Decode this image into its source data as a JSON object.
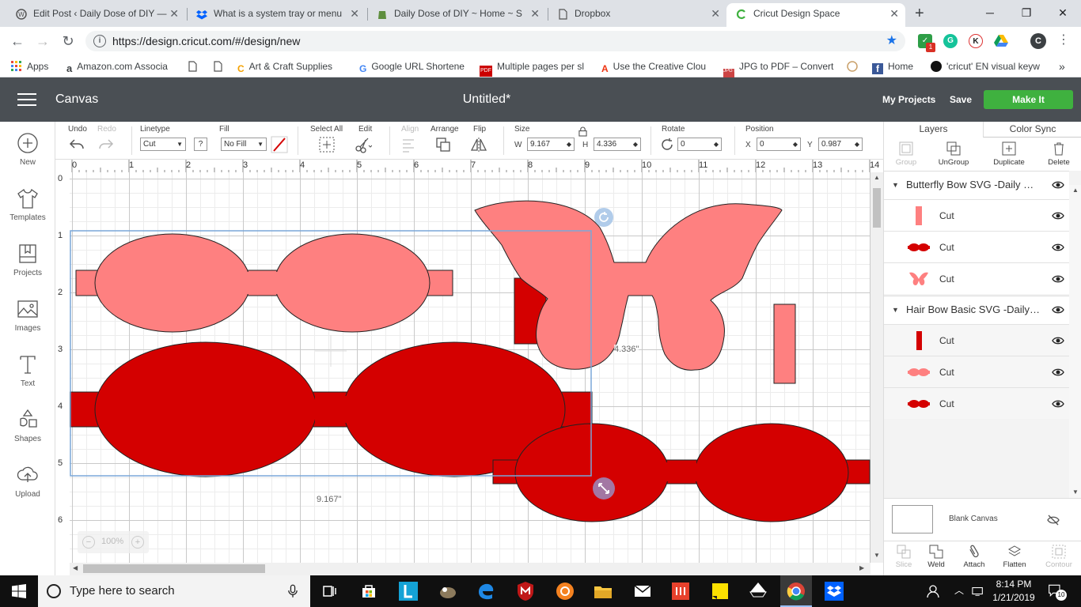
{
  "browser": {
    "tabs": [
      {
        "title": "Edit Post ‹ Daily Dose of DIY —",
        "active": false
      },
      {
        "title": "What is a system tray or menu",
        "active": false
      },
      {
        "title": "Daily Dose of DIY ~ Home ~ S",
        "active": false
      },
      {
        "title": "Dropbox",
        "active": false
      },
      {
        "title": "Cricut Design Space",
        "active": true
      }
    ],
    "new_tab": "+",
    "url": "https://design.cricut.com/#/design/new",
    "extension_badge": "1",
    "ext_k": "K",
    "profile": "C",
    "bookmarks": [
      "Apps",
      "Amazon.com Associa",
      "",
      "",
      "Art & Craft Supplies",
      "Google URL Shortene",
      "Multiple pages per sl",
      "Use the Creative Clou",
      "JPG to PDF – Convert",
      "",
      "Home",
      "'cricut' EN visual keyw"
    ],
    "more_bookmarks": "»"
  },
  "header": {
    "app_title": "Canvas",
    "doc_name": "Untitled*",
    "my_projects": "My Projects",
    "save": "Save",
    "make_it": "Make It"
  },
  "sidebar": {
    "items": [
      {
        "label": "New",
        "icon": "plus-circle-icon"
      },
      {
        "label": "Templates",
        "icon": "tshirt-icon"
      },
      {
        "label": "Projects",
        "icon": "projects-icon"
      },
      {
        "label": "Images",
        "icon": "images-icon"
      },
      {
        "label": "Text",
        "icon": "text-icon"
      },
      {
        "label": "Shapes",
        "icon": "shapes-icon"
      },
      {
        "label": "Upload",
        "icon": "upload-icon"
      }
    ]
  },
  "toolbar": {
    "undo": "Undo",
    "redo": "Redo",
    "linetype_label": "Linetype",
    "linetype_value": "Cut",
    "help": "?",
    "fill_label": "Fill",
    "fill_value": "No Fill",
    "select_all": "Select All",
    "edit": "Edit",
    "align": "Align",
    "arrange": "Arrange",
    "flip": "Flip",
    "size_label": "Size",
    "w_label": "W",
    "w_value": "9.167",
    "h_label": "H",
    "h_value": "4.336",
    "rotate_label": "Rotate",
    "rotate_value": "0",
    "position_label": "Position",
    "x_label": "X",
    "x_value": "0",
    "y_label": "Y",
    "y_value": "0.987"
  },
  "canvas": {
    "ruler_top": [
      "0",
      "1",
      "2",
      "3",
      "4",
      "5",
      "6",
      "7",
      "8",
      "9",
      "10",
      "11",
      "12",
      "13",
      "14"
    ],
    "ruler_left": [
      "0",
      "1",
      "2",
      "3",
      "4",
      "5",
      "6"
    ],
    "width_dim": "9.167\"",
    "height_dim": "4.336\"",
    "zoom": "100%",
    "zoom_minus": "−",
    "zoom_plus": "+",
    "colors": {
      "pink": "#fe8080",
      "red": "#d40000",
      "selection": "#7aa7d8"
    }
  },
  "right_panel": {
    "tabs": [
      "Layers",
      "Color Sync"
    ],
    "tools": [
      {
        "label": "Group",
        "enabled": false
      },
      {
        "label": "UnGroup",
        "enabled": true
      },
      {
        "label": "Duplicate",
        "enabled": true
      },
      {
        "label": "Delete",
        "enabled": true
      }
    ],
    "groups": [
      {
        "name": "Butterfly Bow SVG -Daily Dose of DIY",
        "layers": [
          {
            "op": "Cut",
            "swatch": "pink-rect"
          },
          {
            "op": "Cut",
            "swatch": "red-bow"
          },
          {
            "op": "Cut",
            "swatch": "pink-butterfly"
          }
        ]
      },
      {
        "name": "Hair Bow Basic SVG -Daily Dose of DIY",
        "layers": [
          {
            "op": "Cut",
            "swatch": "red-rect"
          },
          {
            "op": "Cut",
            "swatch": "pink-bow"
          },
          {
            "op": "Cut",
            "swatch": "red-bow"
          }
        ]
      }
    ],
    "blank_canvas": "Blank Canvas",
    "bottom_tools": [
      {
        "label": "Slice",
        "enabled": false
      },
      {
        "label": "Weld",
        "enabled": true
      },
      {
        "label": "Attach",
        "enabled": true
      },
      {
        "label": "Flatten",
        "enabled": true
      },
      {
        "label": "Contour",
        "enabled": false
      }
    ]
  },
  "taskbar": {
    "search_placeholder": "Type here to search",
    "time": "8:14 PM",
    "date": "1/21/2019",
    "notifications": "10"
  }
}
